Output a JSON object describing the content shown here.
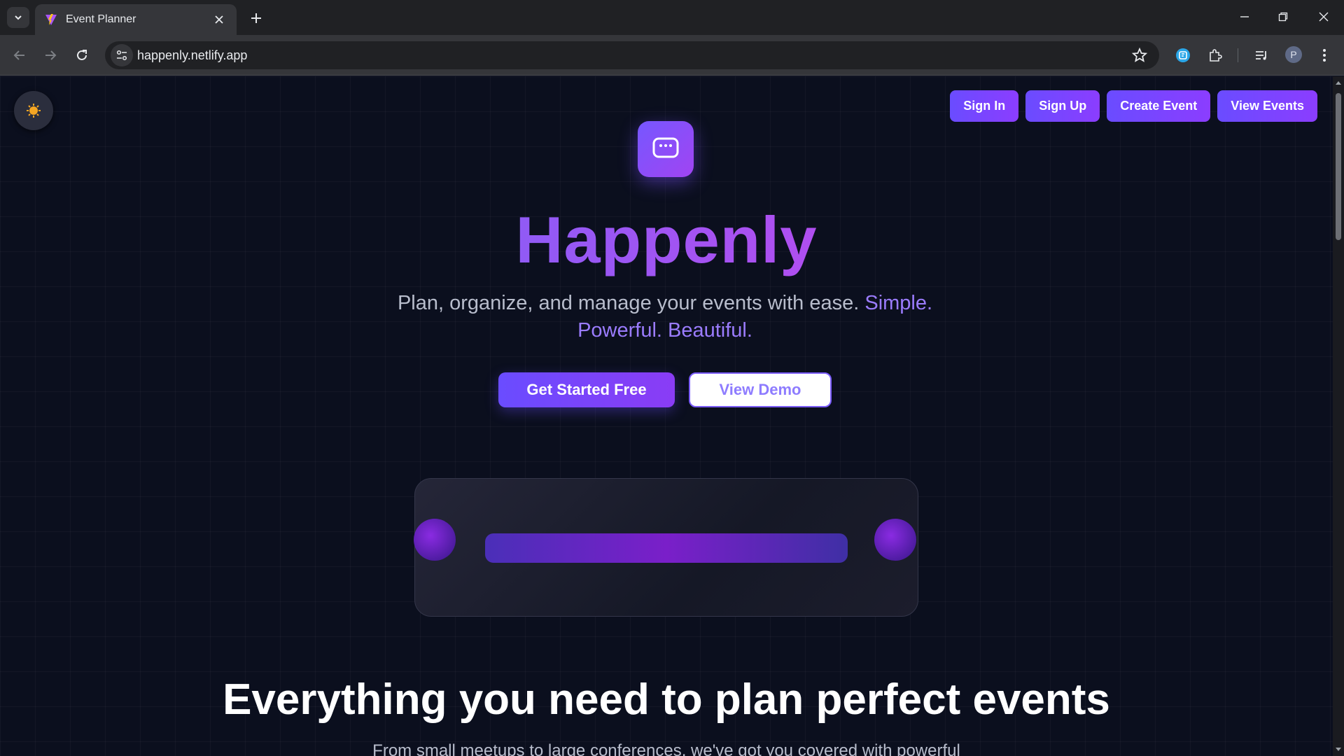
{
  "browser": {
    "tab_title": "Event Planner",
    "url": "happenly.netlify.app",
    "profile_initial": "P"
  },
  "nav": {
    "sign_in": "Sign In",
    "sign_up": "Sign Up",
    "create_event": "Create Event",
    "view_events": "View Events"
  },
  "hero": {
    "title": "Happenly",
    "subtitle_main": "Plan, organize, and manage your events with ease.",
    "subtitle_accent": "Simple. Powerful. Beautiful.",
    "cta_primary": "Get Started Free",
    "cta_secondary": "View Demo"
  },
  "features": {
    "title": "Everything you need to plan perfect events",
    "subtitle": "From small meetups to large conferences, we've got you covered with powerful"
  },
  "colors": {
    "accent": "#6a4cff",
    "accent_purple": "#8b3dff",
    "background": "#0b0f1e"
  }
}
